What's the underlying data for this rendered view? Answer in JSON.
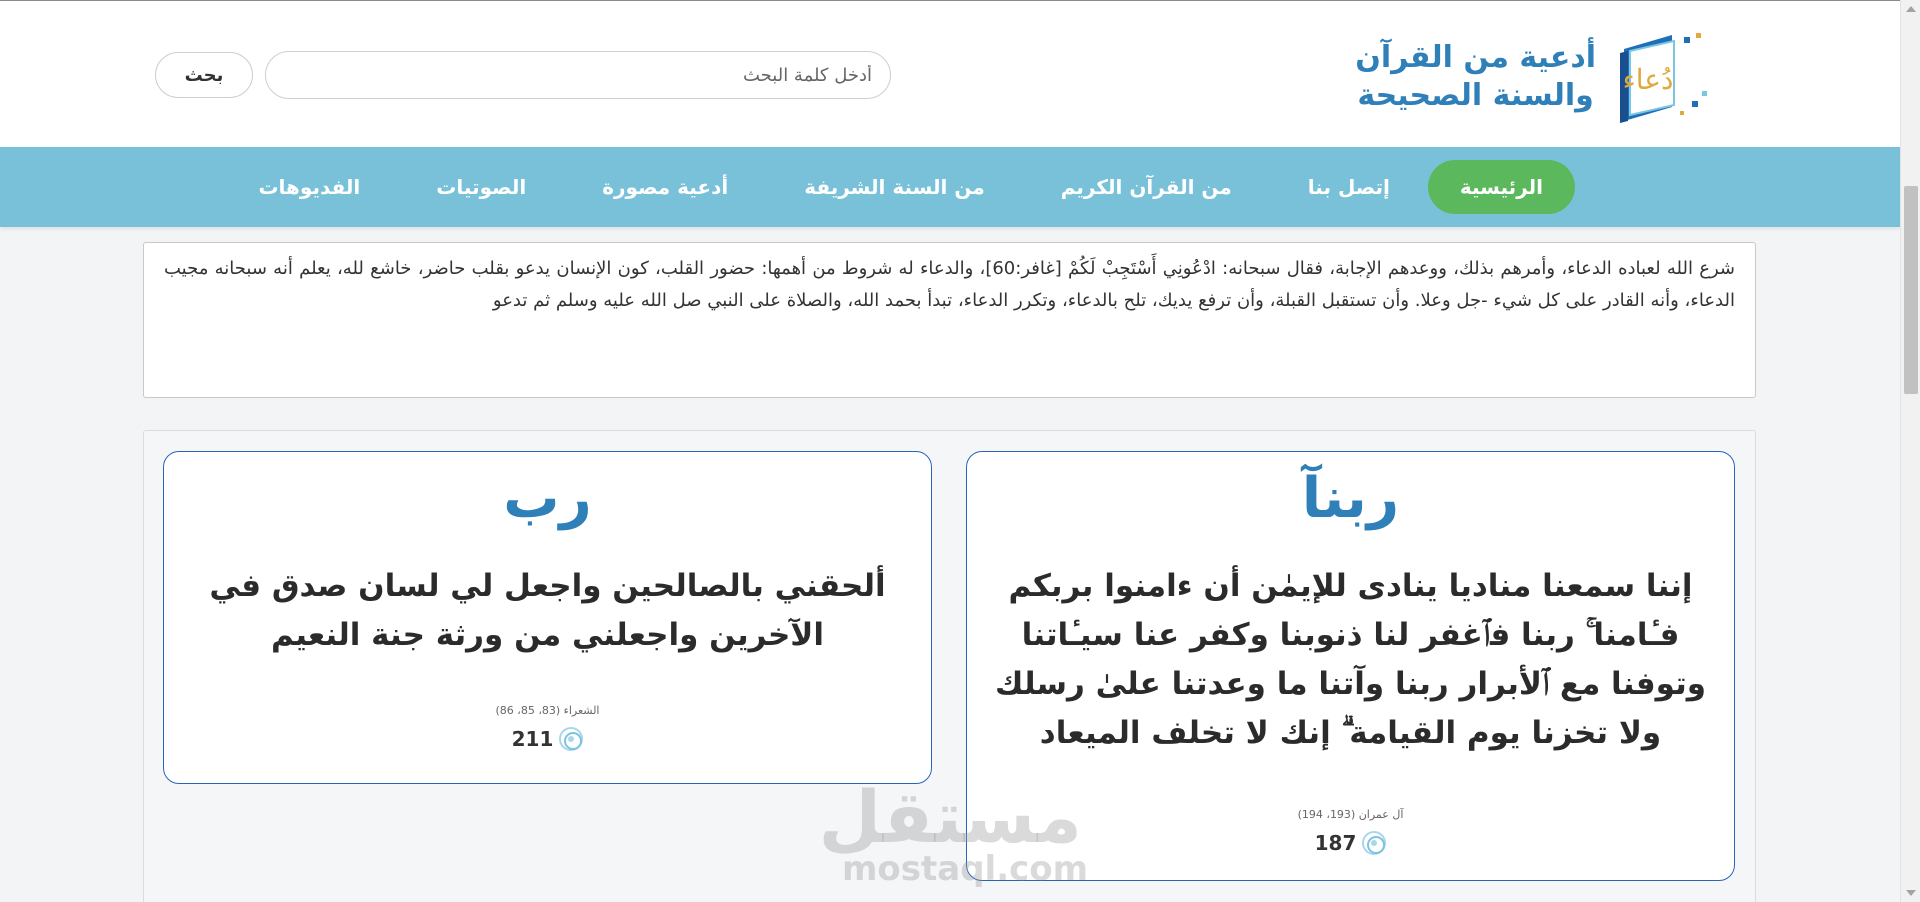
{
  "header": {
    "logo_line1": "أدعية من القرآن",
    "logo_line2": "والسنة الصحيحة",
    "logo_mark_text": "دُعاء",
    "search_placeholder": "أدخل كلمة البحث",
    "search_button": "بحث"
  },
  "nav": {
    "items": [
      {
        "label": "الرئيسية",
        "active": true
      },
      {
        "label": "إتصل بنا"
      },
      {
        "label": "من القرآن الكريم"
      },
      {
        "label": "من السنة الشريفة"
      },
      {
        "label": "أدعية مصورة"
      },
      {
        "label": "الصوتيات"
      },
      {
        "label": "الفديوهات"
      }
    ],
    "active_color": "#5cb85c",
    "bar_color": "#78c1d8"
  },
  "intro": {
    "text": "شرع الله لعباده الدعاء، وأمرهم بذلك، ووعدهم الإجابة، فقال سبحانه: ادْعُونِي أَسْتَجِبْ لَكُمْ [غافر:60]، والدعاء له شروط من أهمها: حضور القلب، كون الإنسان يدعو بقلب حاضر، خاشع لله، يعلم أنه سبحانه مجيب الدعاء، وأنه القادر على كل شيء -جل وعلا. وأن تستقبل القبلة، وأن ترفع يديك، تلح بالدعاء، وتكرر الدعاء، تبدأ بحمد الله، والصلاة على النبي صل الله عليه وسلم ثم تدعو"
  },
  "cards": [
    {
      "title": "ربنآ",
      "text": "إننا سمعنا مناديا ينادى للإيمٰن أن ءامنوا بربكم فـٔامنا ۚ ربنا فٱغفر لنا ذنوبنا وكفر عنا سيـٔاتنا وتوفنا مع ٱلأبرار ربنا وآتنا ما وعدتنا علىٰ رسلك ولا تخزنا يوم القيامة ۗ إنك لا تخلف الميعاد",
      "reference": "آل عمران (193، 194)",
      "count": "187"
    },
    {
      "title": "رب",
      "text": "ألحقني بالصالحين واجعل لي لسان صدق في الآخرين واجعلني من ورثة جنة النعيم",
      "reference": "الشعراء (83، 85، 86)",
      "count": "211"
    }
  ],
  "watermark": {
    "arabic": "مستقل",
    "latin": "mostaql.com"
  },
  "icons": {
    "count": "circle-target-icon",
    "logo": "book-logo-icon"
  }
}
